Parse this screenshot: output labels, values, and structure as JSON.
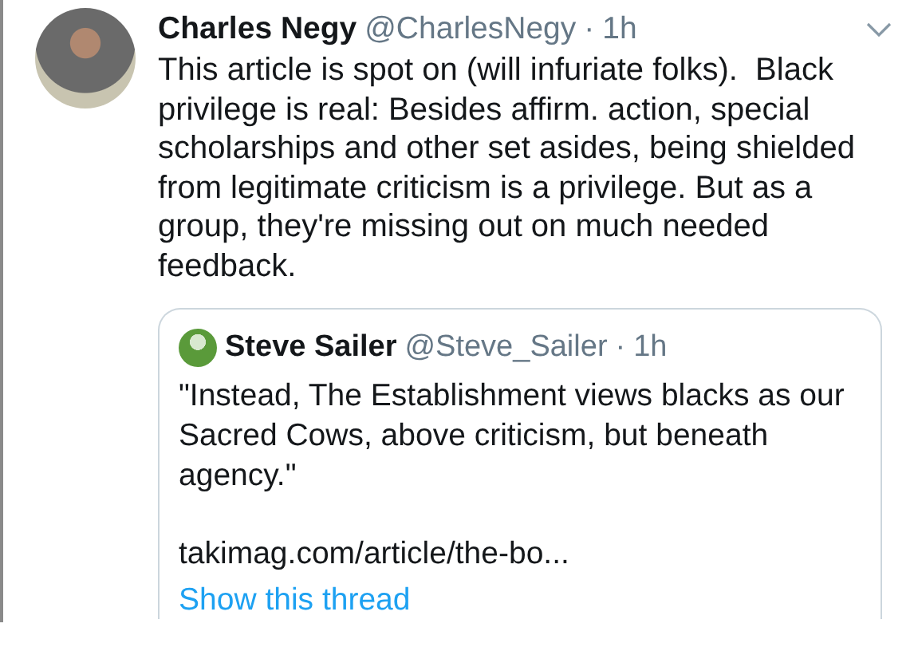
{
  "tweet": {
    "author": "Charles Negy",
    "handle": "@CharlesNegy",
    "separator": "·",
    "time": "1h",
    "text": "This article is spot on (will infuriate folks).  Black privilege is real: Besides affirm. action, special scholarships and other set asides, being shielded from legitimate criticism is a privilege. But as a group, they're missing out on much needed feedback.",
    "quoted": {
      "author": "Steve Sailer",
      "handle": "@Steve_Sailer",
      "separator": "·",
      "time": "1h",
      "text": "\"Instead, The Establishment views blacks as our Sacred Cows, above criticism, but beneath agency.\"",
      "link": "takimag.com/article/the-bo...",
      "thread_link": "Show this thread"
    }
  }
}
